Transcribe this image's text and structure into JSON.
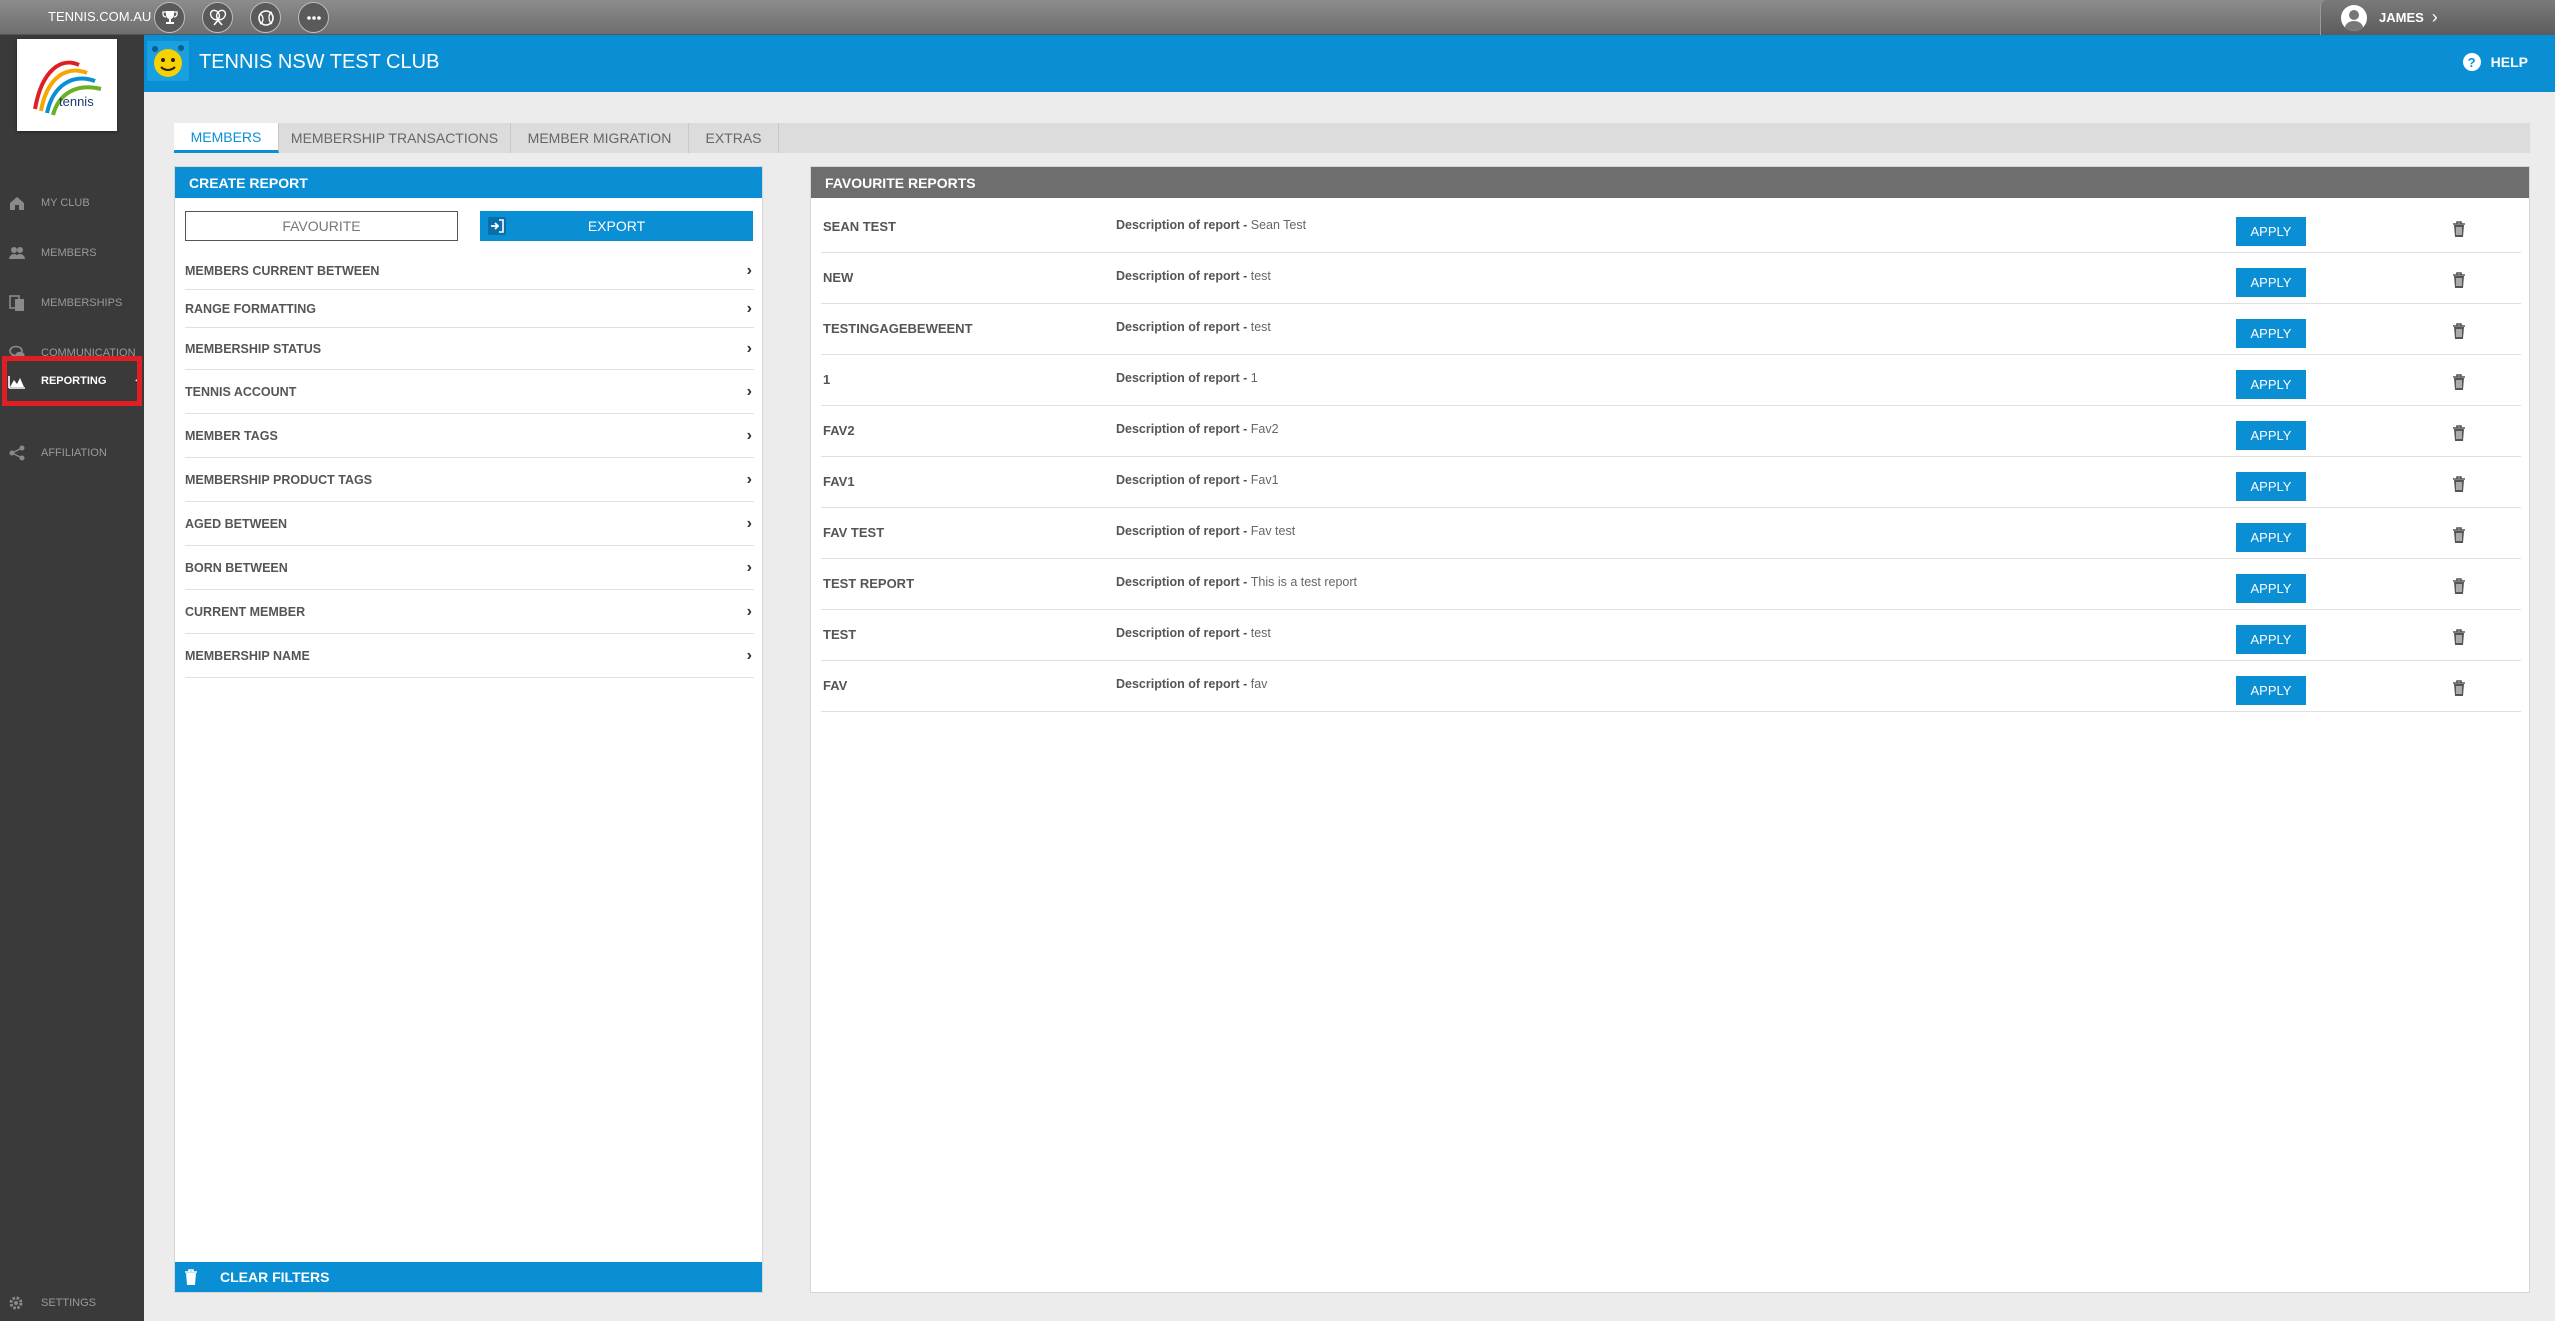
{
  "topbar": {
    "site_link": "TENNIS.COM.AU",
    "icons": [
      "trophy-icon",
      "rackets-icon",
      "ball-icon",
      "more-icon"
    ],
    "user_name": "JAMES"
  },
  "header": {
    "club_name": "TENNIS NSW TEST CLUB",
    "help_label": "HELP"
  },
  "sidebar": {
    "logo_text": "tennis",
    "items": [
      {
        "label": "MY CLUB",
        "icon": "home-icon"
      },
      {
        "label": "MEMBERS",
        "icon": "members-icon"
      },
      {
        "label": "MEMBERSHIPS",
        "icon": "memberships-icon"
      },
      {
        "label": "COMMUNICATION",
        "icon": "chat-icon"
      },
      {
        "label": "REPORTING",
        "icon": "chart-icon",
        "active": true
      },
      {
        "label": "AFFILIATION",
        "icon": "share-icon"
      }
    ],
    "settings_label": "SETTINGS"
  },
  "tabs": [
    {
      "label": "MEMBERS",
      "active": true
    },
    {
      "label": "MEMBERSHIP TRANSACTIONS"
    },
    {
      "label": "MEMBER MIGRATION"
    },
    {
      "label": "EXTRAS"
    }
  ],
  "create_report": {
    "title": "CREATE REPORT",
    "favourite_label": "FAVOURITE",
    "export_label": "EXPORT",
    "filters": [
      "MEMBERS CURRENT BETWEEN",
      "RANGE FORMATTING",
      "MEMBERSHIP STATUS",
      "TENNIS ACCOUNT",
      "MEMBER TAGS",
      "MEMBERSHIP PRODUCT TAGS",
      "AGED BETWEEN",
      "BORN BETWEEN",
      "CURRENT MEMBER",
      "MEMBERSHIP NAME"
    ],
    "clear_label": "CLEAR FILTERS"
  },
  "favourite_reports": {
    "title": "FAVOURITE REPORTS",
    "desc_prefix": "Description of report - ",
    "apply_label": "APPLY",
    "rows": [
      {
        "name": "SEAN TEST",
        "desc": "Sean Test"
      },
      {
        "name": "NEW",
        "desc": "test"
      },
      {
        "name": "TESTINGAGEBEWEENT",
        "desc": "test"
      },
      {
        "name": "1",
        "desc": "1"
      },
      {
        "name": "FAV2",
        "desc": "Fav2"
      },
      {
        "name": "FAV1",
        "desc": "Fav1"
      },
      {
        "name": "FAV TEST",
        "desc": "Fav test"
      },
      {
        "name": "TEST REPORT",
        "desc": "This is a test report"
      },
      {
        "name": "TEST",
        "desc": "test"
      },
      {
        "name": "FAV",
        "desc": "fav"
      }
    ]
  },
  "colors": {
    "brand_blue": "#0a8fd4",
    "sidebar": "#3a3a3a",
    "highlight_red": "#e01e25"
  }
}
